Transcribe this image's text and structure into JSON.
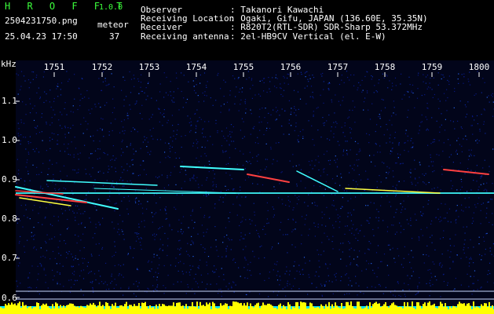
{
  "app": {
    "brand": "H R O F F T",
    "version": "1.0.0"
  },
  "file": {
    "name": "2504231750.png",
    "datetime": "25.04.23 17:50"
  },
  "meteor": {
    "label": "meteor",
    "count": "37"
  },
  "info": [
    {
      "key": "Observer",
      "value": ": Takanori Kawachi"
    },
    {
      "key": "Receiving Location",
      "value": ": Ogaki, Gifu, JAPAN (136.60E, 35.35N)"
    },
    {
      "key": "Receiver",
      "value": ": R820T2(RTL-SDR) SDR-Sharp 53.372MHz"
    },
    {
      "key": "Receiving antenna",
      "value": ": 2el-HB9CV Vertical (el. E-W)"
    }
  ],
  "axes": {
    "y_unit": "kHz",
    "y_ticks": [
      "1.1",
      "1.0",
      "0.9",
      "0.8",
      "0.7",
      "0.6"
    ],
    "x_ticks": [
      "1751",
      "1752",
      "1753",
      "1754",
      "1755",
      "1756",
      "1757",
      "1758",
      "1759",
      "1800"
    ]
  },
  "colors": {
    "accent_green": "#3cff3c",
    "background": "#000000",
    "noise": "#0a1a8c",
    "trace_hot": "#ff4040",
    "trace_warm": "#ffff40",
    "trace_cyan": "#40ffff",
    "level_yellow": "#ffff00",
    "level_cyan": "#00e0ff"
  }
}
